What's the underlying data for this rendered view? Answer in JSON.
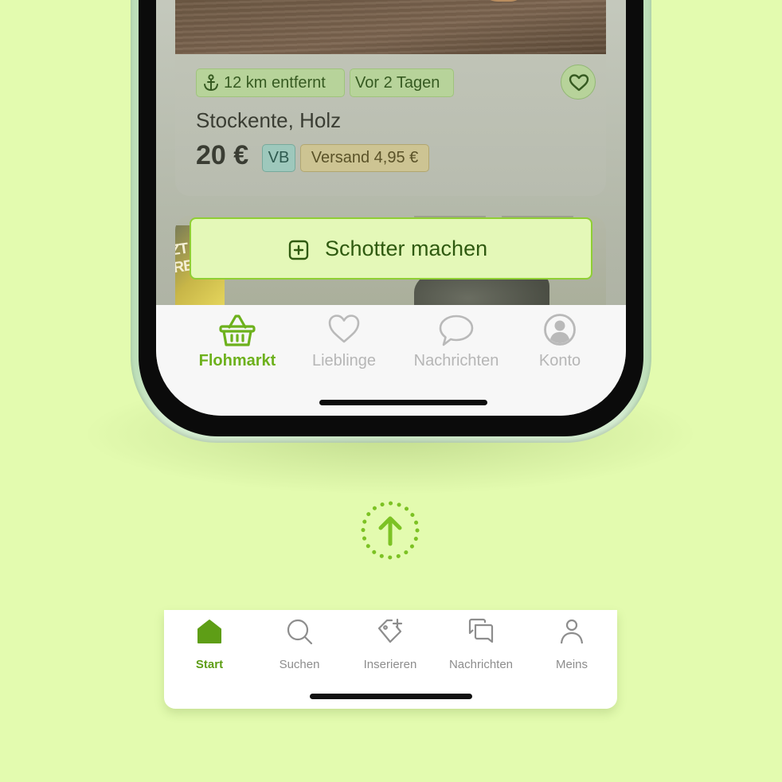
{
  "listing": {
    "distance": "12 km entfernt",
    "age": "Vor 2 Tagen",
    "title": "Stockente, Holz",
    "price": "20 €",
    "negotiable": "VB",
    "shipping": "Versand 4,95 €"
  },
  "listing2": {
    "banner_text": "ZT\nRBEN"
  },
  "cta": {
    "label": "Schotter machen",
    "icon": "plus-square-icon"
  },
  "old_tabbar": {
    "items": [
      {
        "label": "Flohmarkt",
        "icon": "basket-icon",
        "active": true
      },
      {
        "label": "Lieblinge",
        "icon": "heart-icon",
        "active": false
      },
      {
        "label": "Nachrichten",
        "icon": "speech-bubble-icon",
        "active": false
      },
      {
        "label": "Konto",
        "icon": "account-circle-icon",
        "active": false
      }
    ]
  },
  "transition": {
    "icon": "arrow-up-dotted-circle-icon"
  },
  "new_tabbar": {
    "items": [
      {
        "label": "Start",
        "icon": "home-icon",
        "active": true
      },
      {
        "label": "Suchen",
        "icon": "search-icon",
        "active": false
      },
      {
        "label": "Inserieren",
        "icon": "tag-plus-icon",
        "active": false
      },
      {
        "label": "Nachrichten",
        "icon": "chat-icon",
        "active": false
      },
      {
        "label": "Meins",
        "icon": "person-icon",
        "active": false
      }
    ]
  },
  "colors": {
    "background": "#e3fbaf",
    "accent": "#6db11c",
    "inactive": "#b6b6b6"
  }
}
